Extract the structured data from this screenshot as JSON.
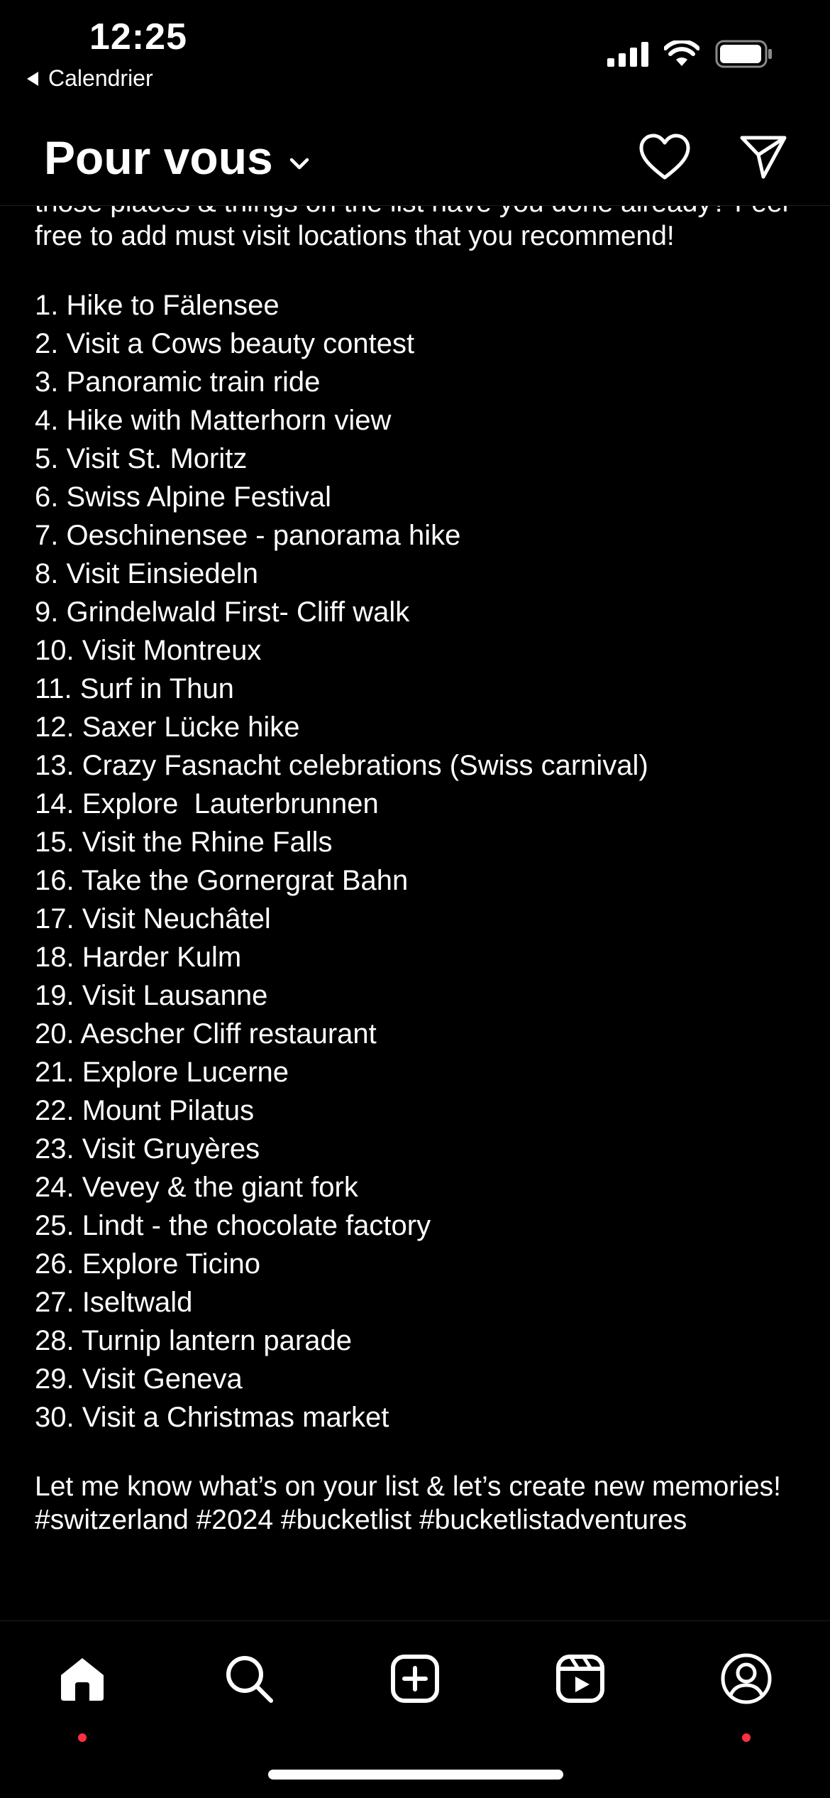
{
  "status_bar": {
    "time": "12:25",
    "back_label": "Calendrier"
  },
  "header": {
    "title": "Pour vous",
    "actions": [
      "heart-icon",
      "send-icon"
    ]
  },
  "caption": {
    "intro": "those places & things on the list have you done already? Feel free to add must visit locations that you recommend!",
    "items": [
      "1. Hike to Fälensee",
      "2. Visit a Cows beauty contest",
      "3. Panoramic train ride",
      "4. Hike with Matterhorn view",
      "5. Visit St. Moritz",
      "6. Swiss Alpine Festival",
      "7. Oeschinensee - panorama hike",
      "8. Visit Einsiedeln",
      "9. Grindelwald First- Cliff walk",
      "10. Visit Montreux",
      "11. Surf in Thun",
      "12. Saxer Lücke hike",
      "13. Crazy Fasnacht celebrations (Swiss carnival)",
      "14. Explore  Lauterbrunnen",
      "15. Visit the Rhine Falls",
      "16. Take the Gornergrat Bahn",
      "17. Visit Neuchâtel",
      "18. Harder Kulm",
      "19. Visit Lausanne",
      "20. Aescher Cliff restaurant",
      "21. Explore Lucerne",
      "22. Mount Pilatus",
      "23. Visit Gruyères",
      "24. Vevey & the giant fork",
      "25. Lindt - the chocolate factory",
      "26. Explore Ticino",
      "27. Iseltwald",
      "28. Turnip lantern parade",
      "29. Visit Geneva",
      "30. Visit a Christmas market"
    ],
    "closing": "Let me know what’s on your list & let’s create new memories!",
    "hashtags": "#switzerland #2024 #bucketlist #bucketlistadventures"
  },
  "tab_bar": {
    "tabs": [
      "home-icon",
      "search-icon",
      "create-icon",
      "reels-icon",
      "profile-icon"
    ],
    "active": "home-icon",
    "notification_color": "#ff3040"
  }
}
